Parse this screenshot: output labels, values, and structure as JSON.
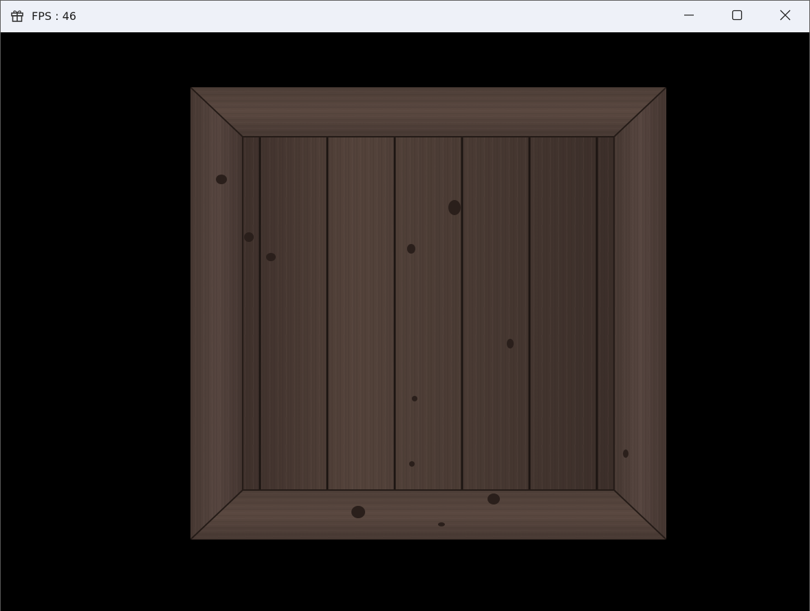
{
  "window": {
    "title": "FPS : 46",
    "icon": "gift-box-icon"
  },
  "caption_buttons": {
    "minimize": "minimize-icon",
    "maximize": "maximize-icon",
    "close": "close-icon"
  },
  "scene": {
    "background": "#000000",
    "object": "wooden-crate",
    "wood_color": "#4a3a33"
  }
}
